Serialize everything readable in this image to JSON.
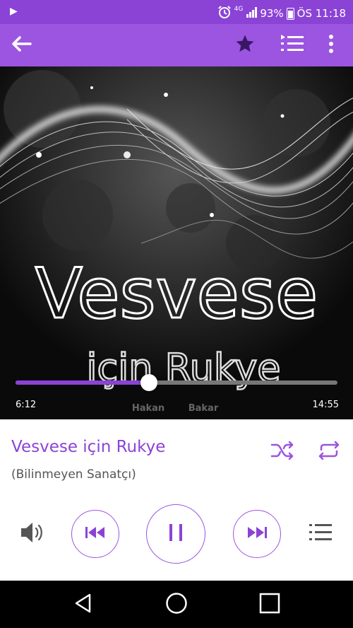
{
  "status_bar": {
    "play_indicator": "▶",
    "network": "4G",
    "battery_percent": "93%",
    "time": "ÖS 11:18",
    "icons": [
      "play-notification-icon",
      "alarm-icon",
      "signal-icon",
      "battery-icon"
    ]
  },
  "toolbar": {
    "icons": [
      "back-arrow-icon",
      "star-icon",
      "queue-icon",
      "more-vert-icon"
    ]
  },
  "album_art": {
    "line1": "Vesvese",
    "line2": "için Rukye",
    "watermark_left": "Hakan",
    "watermark_right": "Bakar"
  },
  "player": {
    "progress_fraction": 0.415,
    "elapsed": "6:12",
    "duration": "14:55"
  },
  "track": {
    "title": "Vesvese için Rukye",
    "artist": "(Bilinmeyen Sanatçı)"
  },
  "controls": {
    "icons": [
      "shuffle-icon",
      "repeat-icon",
      "volume-icon",
      "previous-icon",
      "pause-icon",
      "next-icon",
      "playlist-icon"
    ]
  },
  "colors": {
    "accent": "#8b43d6",
    "toolbar": "#9b55e0"
  },
  "nav_bar": {
    "icons": [
      "back-triangle-icon",
      "home-circle-icon",
      "recents-square-icon"
    ]
  }
}
